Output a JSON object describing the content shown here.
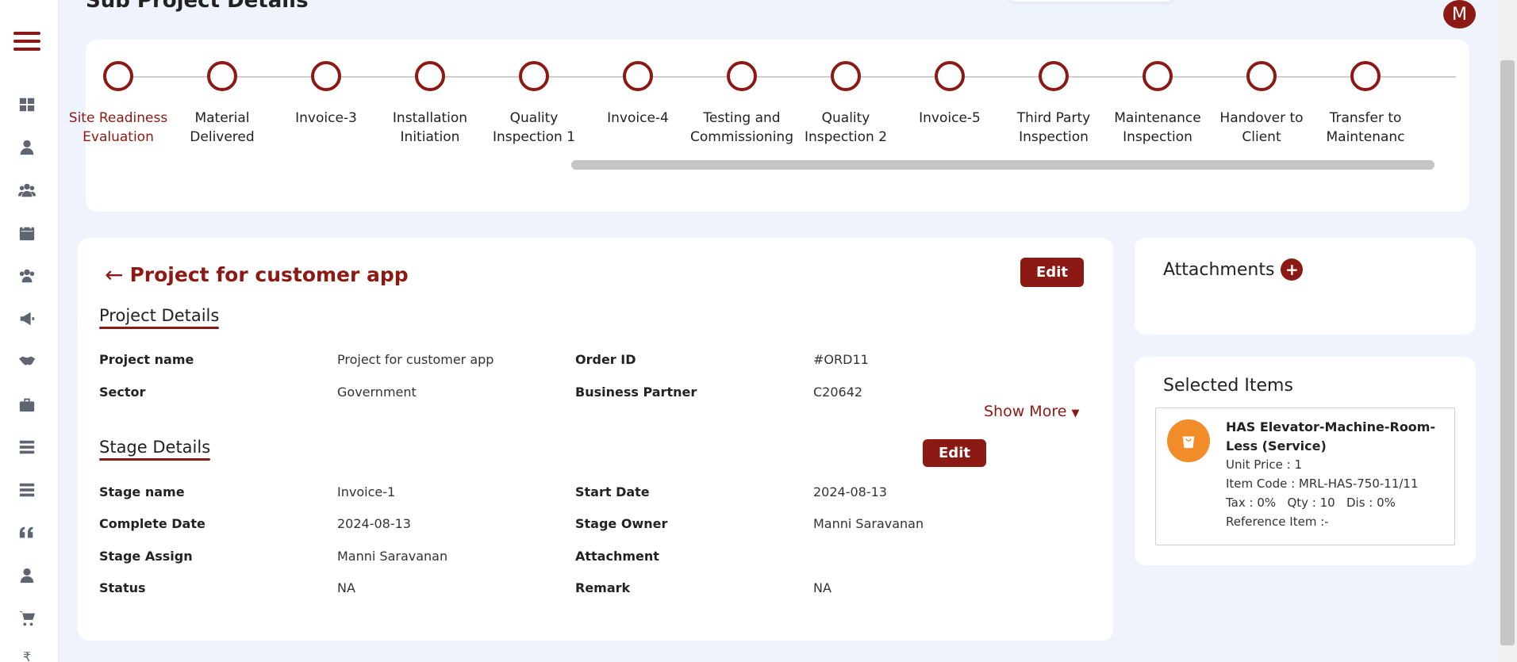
{
  "header": {
    "page_title": "Sub Project Details",
    "avatar_initial": "M"
  },
  "stages": [
    {
      "label": "Site Readiness\nEvaluation",
      "active": true
    },
    {
      "label": "Material\nDelivered"
    },
    {
      "label": "Invoice-3"
    },
    {
      "label": "Installation\nInitiation"
    },
    {
      "label": "Quality\nInspection 1"
    },
    {
      "label": "Invoice-4"
    },
    {
      "label": "Testing and\nCommissioning"
    },
    {
      "label": "Quality\nInspection 2"
    },
    {
      "label": "Invoice-5"
    },
    {
      "label": "Third Party\nInspection"
    },
    {
      "label": "Maintenance\nInspection"
    },
    {
      "label": "Handover to\nClient"
    },
    {
      "label": "Transfer to\nMaintenanc"
    }
  ],
  "project": {
    "title": "Project for customer app",
    "edit_label": "Edit",
    "section_title": "Project Details",
    "fields": {
      "project_name_label": "Project name",
      "project_name": "Project for customer app",
      "order_id_label": "Order ID",
      "order_id": "#ORD11",
      "sector_label": "Sector",
      "sector": "Government",
      "partner_label": "Business Partner",
      "partner": "C20642"
    },
    "show_more": "Show More"
  },
  "stage": {
    "section_title": "Stage Details",
    "edit_label": "Edit",
    "fields": {
      "stage_name_label": "Stage name",
      "stage_name": "Invoice-1",
      "start_date_label": "Start Date",
      "start_date": "2024-08-13",
      "complete_date_label": "Complete Date",
      "complete_date": "2024-08-13",
      "owner_label": "Stage Owner",
      "owner": "Manni Saravanan",
      "assign_label": "Stage Assign",
      "assign": "Manni Saravanan",
      "attachment_label": "Attachment",
      "status_label": "Status",
      "status": "NA",
      "remark_label": "Remark",
      "remark": "NA"
    }
  },
  "attachments": {
    "title": "Attachments",
    "add_symbol": "+"
  },
  "selected_items": {
    "title": "Selected Items",
    "item": {
      "name": "HAS Elevator-Machine-Room-Less (Service)",
      "unit_price": "Unit Price : 1",
      "item_code": "Item Code : MRL-HAS-750-11/11",
      "tax_qty_dis": "Tax : 0%   Qty : 10   Dis : 0%",
      "reference": "Reference Item :-"
    }
  },
  "colors": {
    "accent": "#8b1a14",
    "item_icon_bg": "#f28c28",
    "page_bg": "#eef3fc"
  },
  "sidebar_icons": [
    "dashboard-icon",
    "user-icon",
    "users-icon",
    "calendar-icon",
    "team-icon",
    "megaphone-icon",
    "handshake-icon",
    "briefcase-icon",
    "list-icon",
    "list-alt-icon",
    "quote-icon",
    "person-icon",
    "cart-icon",
    "rupee-icon"
  ]
}
